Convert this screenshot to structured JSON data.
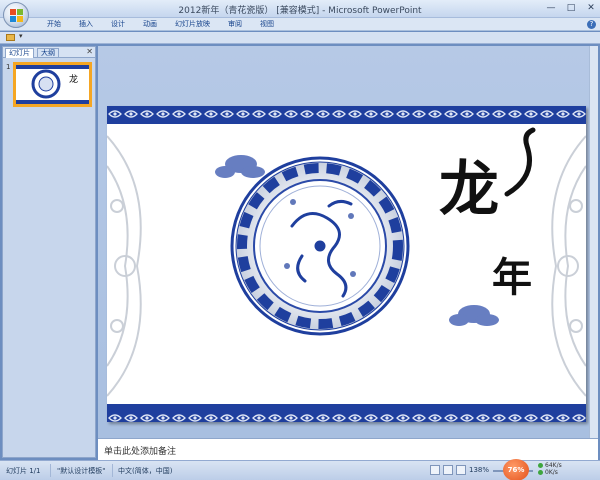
{
  "window": {
    "title": "2012新年（青花瓷版） [兼容模式] - Microsoft PowerPoint"
  },
  "ribbon": {
    "tabs": [
      "开始",
      "插入",
      "设计",
      "动画",
      "幻灯片放映",
      "审阅",
      "视图"
    ]
  },
  "left_pane": {
    "tabs": [
      "幻灯片",
      "大纲"
    ],
    "slide_number": "1"
  },
  "slide": {
    "calligraphy_top": "龙",
    "calligraphy_bottom": "年"
  },
  "notes": {
    "placeholder": "单击此处添加备注"
  },
  "status_bar": {
    "slide_info": "幻灯片 1/1",
    "theme": "\"默认设计模板\"",
    "language": "中文(简体，中国)",
    "zoom": "138%",
    "zoom_badge": "76%",
    "net_up": "64K/s",
    "net_down": "0K/s"
  },
  "colors": {
    "porcelain_blue": "#1f3f9e",
    "thumb_border": "#f5a623",
    "zoom_badge": "#e2501a"
  },
  "icons": {
    "office_button": "office-logo-icon",
    "folder": "folder-icon",
    "help": "help-icon",
    "minimize": "minimize-icon",
    "maximize": "maximize-icon",
    "close": "close-icon"
  }
}
